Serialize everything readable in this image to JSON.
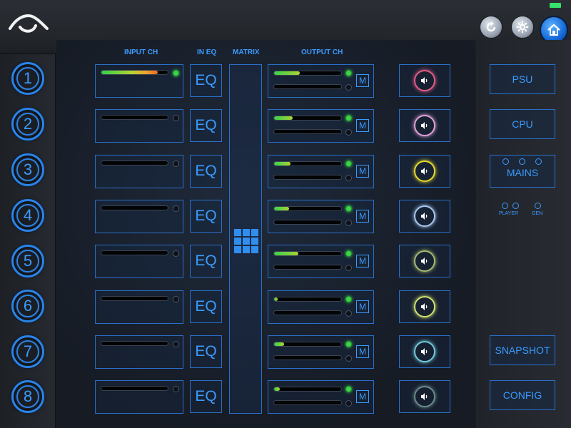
{
  "headers": {
    "input_ch": "INPUT CH",
    "in_eq": "IN EQ",
    "matrix": "MATRIX",
    "output_ch": "OUTPUT CH"
  },
  "channels": [
    {
      "num": "1",
      "eq": "EQ",
      "input_level": 0.85,
      "input_led_on": true,
      "out1_level": 0.38,
      "out1_led_on": true,
      "out2_level": 0.0,
      "m": "M",
      "speaker_color": "#e05a86"
    },
    {
      "num": "2",
      "eq": "EQ",
      "input_level": 0.0,
      "input_led_on": false,
      "out1_level": 0.28,
      "out1_led_on": true,
      "out2_level": 0.0,
      "m": "M",
      "speaker_color": "#e0a0d8"
    },
    {
      "num": "3",
      "eq": "EQ",
      "input_level": 0.0,
      "input_led_on": false,
      "out1_level": 0.24,
      "out1_led_on": true,
      "out2_level": 0.0,
      "m": "M",
      "speaker_color": "#e6d82e"
    },
    {
      "num": "4",
      "eq": "EQ",
      "input_level": 0.0,
      "input_led_on": false,
      "out1_level": 0.22,
      "out1_led_on": true,
      "out2_level": 0.0,
      "m": "M",
      "speaker_color": "#a8c8f0"
    },
    {
      "num": "5",
      "eq": "EQ",
      "input_level": 0.0,
      "input_led_on": false,
      "out1_level": 0.36,
      "out1_led_on": true,
      "out2_level": 0.0,
      "m": "M",
      "speaker_color": "#a8b870"
    },
    {
      "num": "6",
      "eq": "EQ",
      "input_level": 0.0,
      "input_led_on": false,
      "out1_level": 0.05,
      "out1_led_on": true,
      "out2_level": 0.0,
      "m": "M",
      "speaker_color": "#d0e070"
    },
    {
      "num": "7",
      "eq": "EQ",
      "input_level": 0.0,
      "input_led_on": false,
      "out1_level": 0.15,
      "out1_led_on": true,
      "out2_level": 0.0,
      "m": "M",
      "speaker_color": "#70c8d8"
    },
    {
      "num": "8",
      "eq": "EQ",
      "input_level": 0.0,
      "input_led_on": false,
      "out1_level": 0.08,
      "out1_led_on": true,
      "out2_level": 0.0,
      "m": "M",
      "speaker_color": "#6a8a8a"
    }
  ],
  "right": {
    "psu": "PSU",
    "cpu": "CPU",
    "mains": "MAINS",
    "player": "PLAYER",
    "gen": "GEN",
    "snapshot": "SNAPSHOT",
    "config": "CONFIG"
  },
  "icons": {
    "logo": "logo-icon",
    "refresh": "refresh-icon",
    "settings": "gear-icon",
    "home": "home-icon",
    "speaker": "speaker-icon",
    "matrix": "grid-icon"
  }
}
